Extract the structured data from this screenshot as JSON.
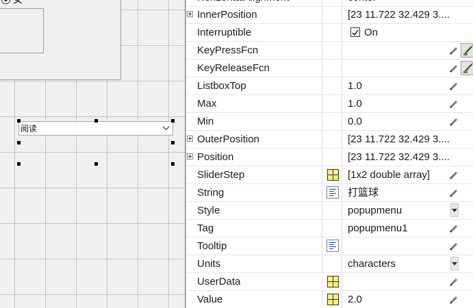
{
  "canvas": {
    "radio_label": "女",
    "popup_value": "阅读"
  },
  "inspector": {
    "partial_top_row": {
      "name": "HorizontalAlignment",
      "value": "center"
    },
    "rows": [
      {
        "name": "InnerPosition",
        "value": "[23 11.722 32.429 3....",
        "expandable": true,
        "icon": ""
      },
      {
        "name": "Interruptible",
        "value": "On",
        "checkbox": true,
        "checked": true,
        "icon": ""
      },
      {
        "name": "KeyPressFcn",
        "value": "",
        "icon": "callback-editor-icon"
      },
      {
        "name": "KeyReleaseFcn",
        "value": "",
        "icon": "callback-editor-icon"
      },
      {
        "name": "ListboxTop",
        "value": "1.0",
        "icon": ""
      },
      {
        "name": "Max",
        "value": "1.0",
        "icon": ""
      },
      {
        "name": "Min",
        "value": "0.0",
        "icon": ""
      },
      {
        "name": "OuterPosition",
        "value": "[23 11.722 32.429 3....",
        "expandable": true,
        "icon": ""
      },
      {
        "name": "Position",
        "value": "[23 11.722 32.429 3....",
        "expandable": true,
        "icon": ""
      },
      {
        "name": "SliderStep",
        "value": "[1x2  double array]",
        "icon": "array-editor-icon"
      },
      {
        "name": "String",
        "value": "打篮球",
        "icon": "text-editor-icon"
      },
      {
        "name": "Style",
        "value": "popupmenu",
        "dropdown": true,
        "icon": ""
      },
      {
        "name": "Tag",
        "value": "popupmenu1",
        "icon": ""
      },
      {
        "name": "Tooltip",
        "value": "",
        "icon": "text-editor-icon"
      },
      {
        "name": "Units",
        "value": "characters",
        "dropdown": true,
        "icon": ""
      },
      {
        "name": "UserData",
        "value": "",
        "icon": "array-editor-icon"
      },
      {
        "name": "Value",
        "value": "2.0",
        "icon": "array-editor-icon"
      }
    ]
  }
}
